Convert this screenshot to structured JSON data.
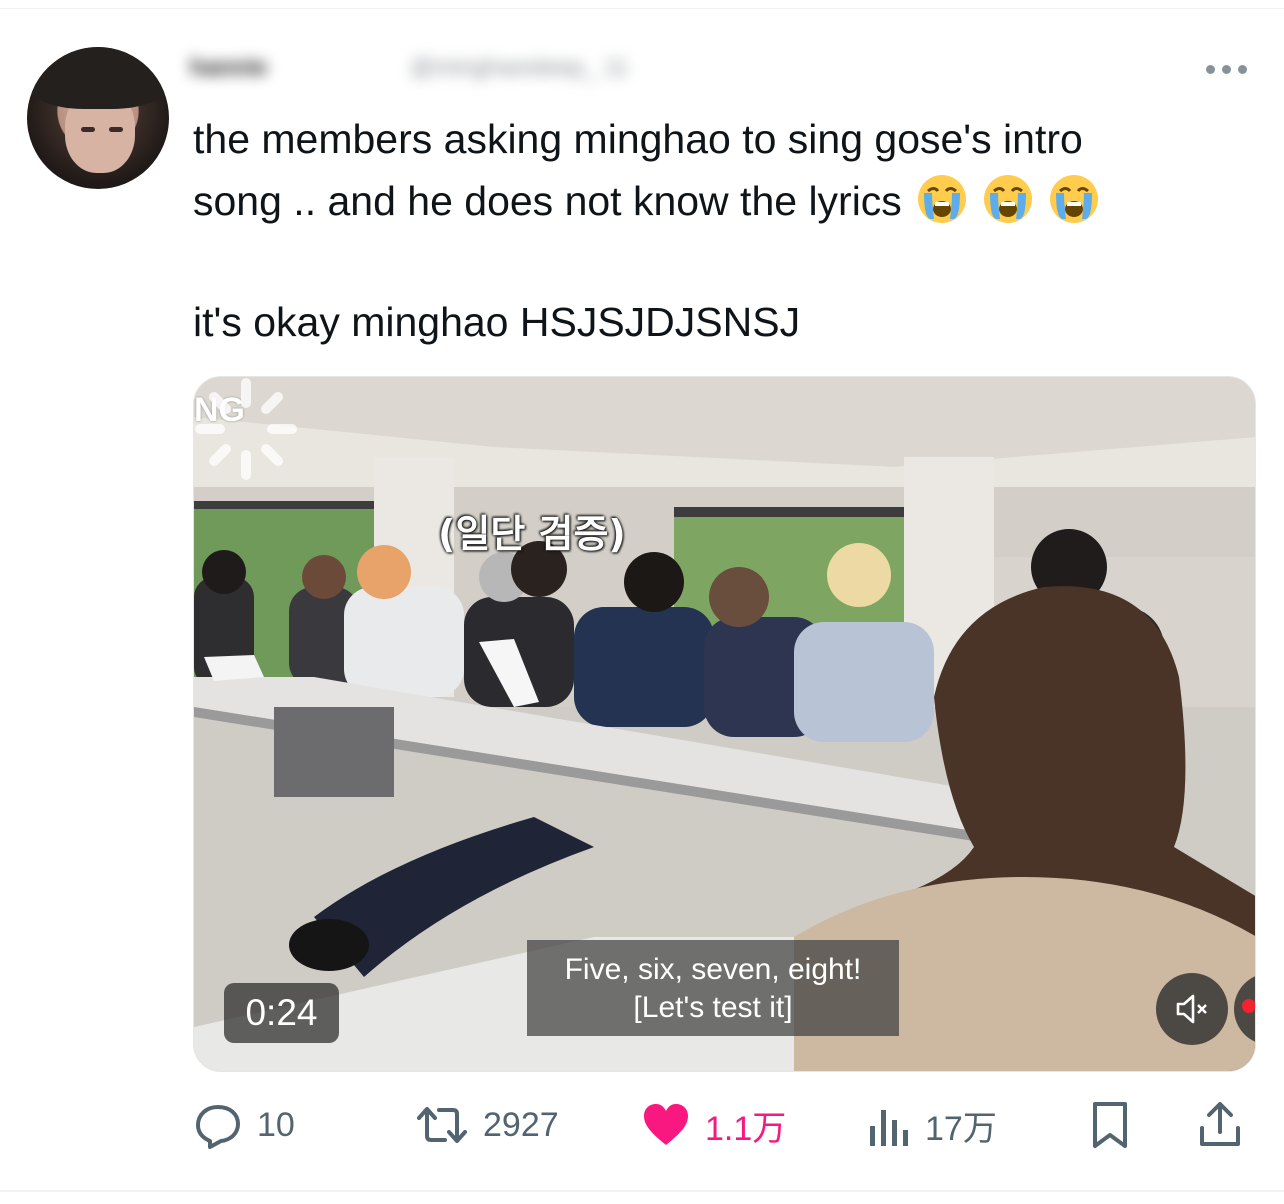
{
  "author": {
    "display_name": "hannie",
    "handle": "@minghaosleep_ 11"
  },
  "tweet": {
    "text_line1": "the members asking minghao to sing gose's intro",
    "text_line2": "song .. and he does not know the lyrics",
    "emojis": [
      "loudly-crying-face-emoji",
      "loudly-crying-face-emoji",
      "loudly-crying-face-emoji"
    ],
    "text_line3": "it's okay minghao HSJSJDJSNSJ"
  },
  "media": {
    "logo_text": "NG",
    "overlay_caption": "(일단 검증)",
    "subtitle_line1": "Five, six, seven, eight!",
    "subtitle_line2": "[Let's test it]",
    "timestamp": "0:24",
    "mute_icon": "speaker-muted-icon"
  },
  "actions": {
    "replies": "10",
    "retweets": "2927",
    "likes": "1.1万",
    "views": "17万"
  },
  "colors": {
    "like_pink": "#f91880",
    "icon_gray": "#536471",
    "live_red": "#f4212e"
  }
}
